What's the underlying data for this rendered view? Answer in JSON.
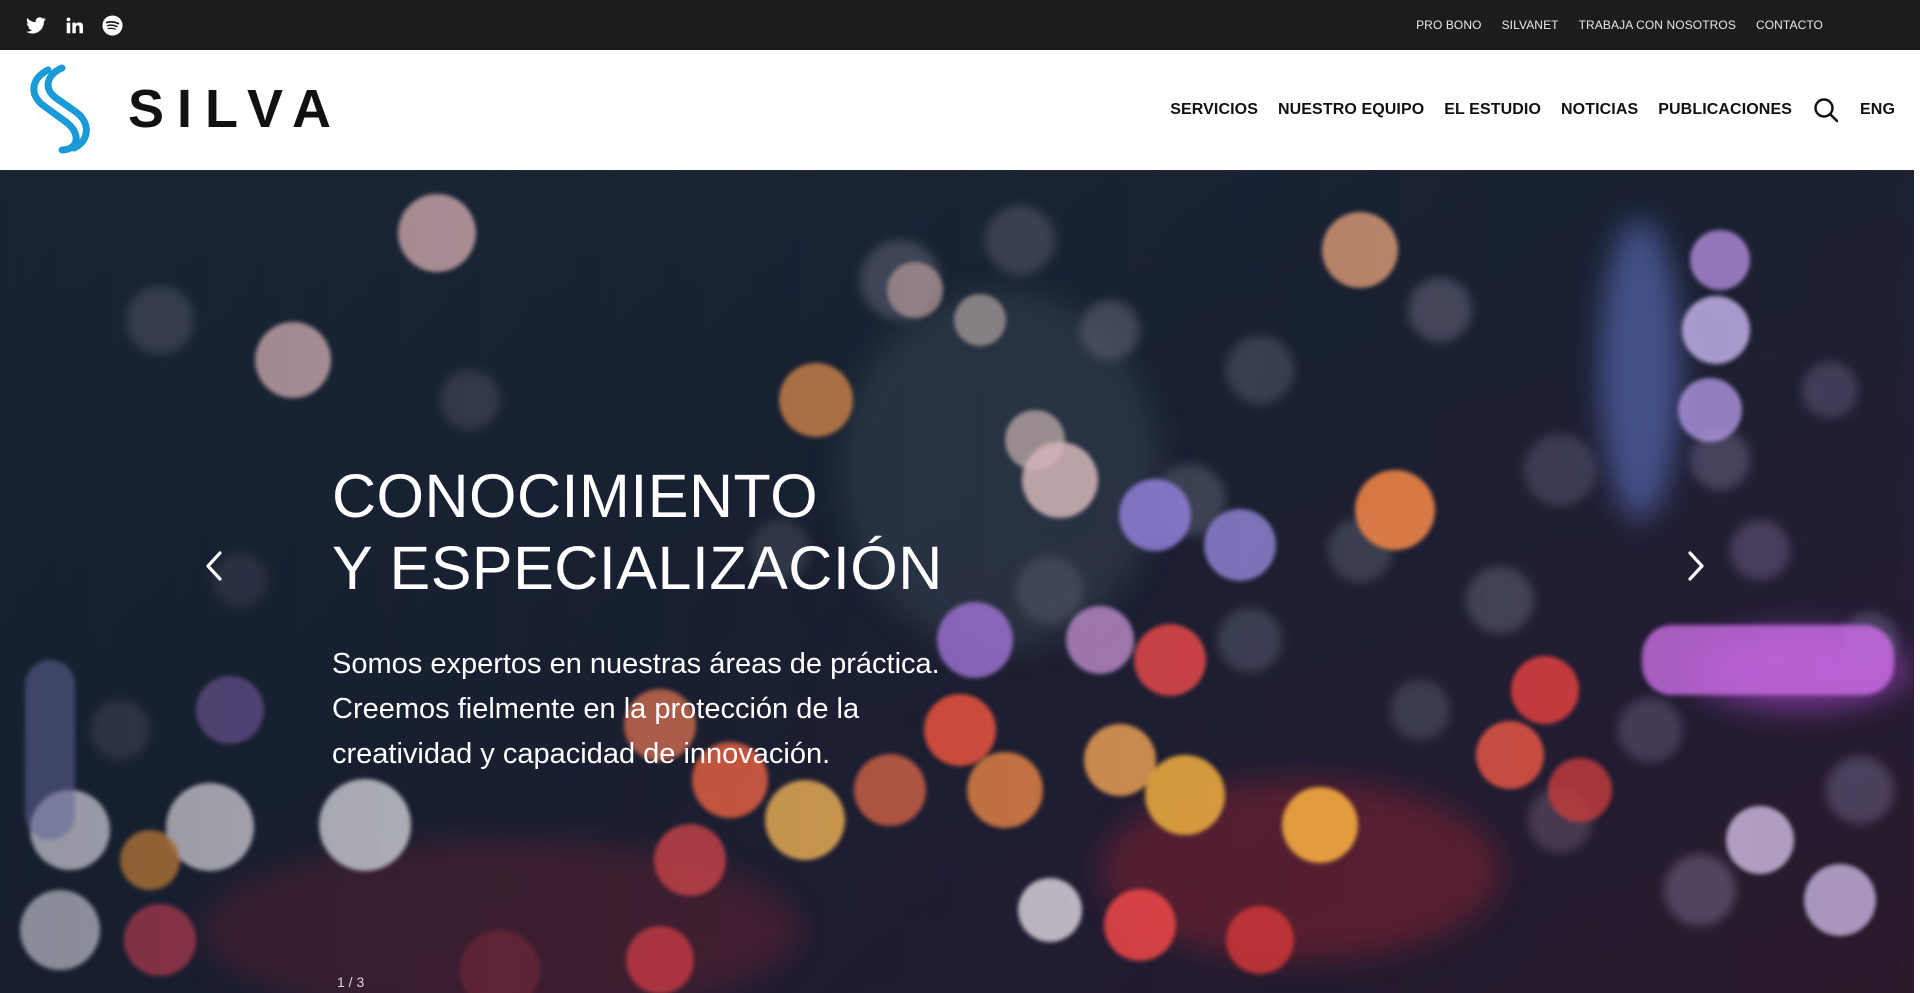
{
  "social": {
    "icons": [
      "twitter-icon",
      "linkedin-icon",
      "spotify-icon"
    ]
  },
  "toplinks": [
    {
      "label": "PRO BONO"
    },
    {
      "label": "SILVANET"
    },
    {
      "label": "TRABAJA CON NOSOTROS"
    },
    {
      "label": "CONTACTO"
    }
  ],
  "logo": {
    "wordmark": "SILVA",
    "mark_color": "#1a9bd7"
  },
  "nav": {
    "items": [
      {
        "label": "SERVICIOS"
      },
      {
        "label": "NUESTRO EQUIPO"
      },
      {
        "label": "EL ESTUDIO"
      },
      {
        "label": "NOTICIAS"
      },
      {
        "label": "PUBLICACIONES"
      }
    ],
    "search_icon": "search-icon",
    "language": "ENG"
  },
  "hero": {
    "title_line1": "CONOCIMIENTO",
    "title_line2": "Y ESPECIALIZACIÓN",
    "description": "Somos expertos en nuestras áreas de práctica. Creemos fielmente en la protección de la creatividad y capacidad de innovación.",
    "counter": "1 / 3",
    "prev_icon": "chevron-left-icon",
    "next_icon": "chevron-right-icon"
  },
  "colors": {
    "topbar": "#1c1c1c",
    "accent": "#1a9bd7",
    "text_dark": "#111111",
    "hero_base": "#18202c"
  }
}
